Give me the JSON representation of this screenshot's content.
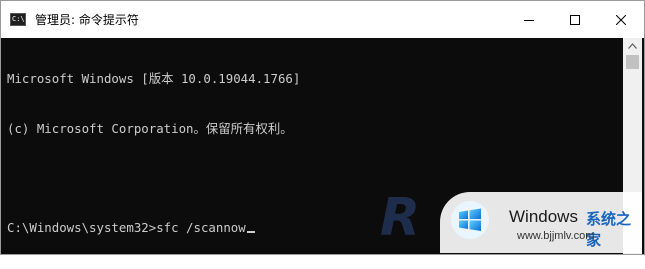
{
  "window": {
    "title": "管理员: 命令提示符",
    "icon_text": "C:\\",
    "controls": {
      "minimize_icon": "minimize-icon",
      "maximize_icon": "maximize-icon",
      "close_icon": "close-icon"
    }
  },
  "console": {
    "lines": [
      "Microsoft Windows [版本 10.0.19044.1766]",
      "(c) Microsoft Corporation。保留所有权利。",
      "",
      "C:\\Windows\\system32>sfc /scannow"
    ]
  },
  "watermark": {
    "letter": "R",
    "brand": "Windows",
    "site_cn": "系统之家",
    "url": "www.bjjmlv.com"
  },
  "colors": {
    "console_bg": "#0c0c0c",
    "console_text": "#cccccc",
    "titlebar_bg": "#ffffff"
  }
}
